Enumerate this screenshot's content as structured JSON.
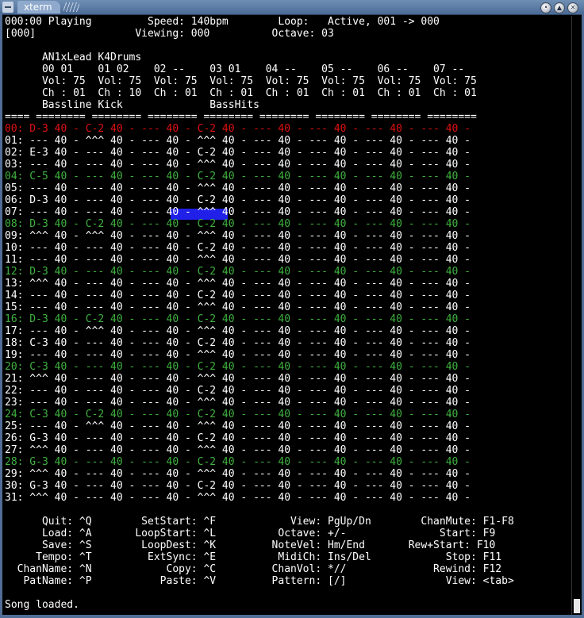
{
  "window": {
    "title": "xterm",
    "buttons": {
      "minimize": "•",
      "maximize": "▲",
      "close": "✕"
    }
  },
  "colors": {
    "accent_green": "#3fb13f",
    "current_row": "#e01010",
    "cursor": "#2020e8"
  },
  "status": {
    "line1": "000:00 Playing         Speed: 140bpm        Loop:   Active, 001 -> 000",
    "line2": "[000]                Viewing: 000          Octave: 03"
  },
  "channels": {
    "line1": "      AN1xLead K4Drums",
    "line2": "      00 01    01 02    02 --    03 01    04 --    05 --    06 --    07 --",
    "line3": "      Vol: 75  Vol: 75  Vol: 75  Vol: 75  Vol: 75  Vol: 75  Vol: 75  Vol: 75",
    "line4": "      Ch : 01  Ch : 10  Ch : 01  Ch : 01  Ch : 01  Ch : 01  Ch : 01  Ch : 01",
    "line5": "      Bassline Kick              BassHits",
    "separator": "==== ======== ======== ======== ======== ======== ======== ======== ========"
  },
  "pattern_rows": [
    "00: D-3 40 - C-2 40 - --- 40 - C-2 40 - --- 40 - --- 40 - --- 40 - --- 40 -",
    "01: --- 40 - ^^^ 40 - --- 40 - ^^^ 40 - --- 40 - --- 40 - --- 40 - --- 40 -",
    "02: E-3 40 - --- 40 - --- 40 - C-2 40 - --- 40 - --- 40 - --- 40 - --- 40 -",
    "03: --- 40 - --- 40 - --- 40 - ^^^ 40 - --- 40 - --- 40 - --- 40 - --- 40 -",
    "04: C-5 40 - --- 40 - --- 40 - C-2 40 - --- 40 - --- 40 - --- 40 - --- 40 -",
    "05: --- 40 - --- 40 - --- 40 - ^^^ 40 - --- 40 - --- 40 - --- 40 - --- 40 -",
    "06: D-3 40 - --- 40 - --- 40 - C-2 40 - --- 40 - --- 40 - --- 40 - --- 40 -",
    "07: --- 40 - --- 40 - --- 40 - ^^^ 40 - --- 40 - --- 40 - --- 40 - --- 40 -",
    "08: D-3 40 - C-2 40 - --- 40 - C-2 40 - --- 40 - --- 40 - --- 40 - --- 40 -",
    "09: ^^^ 40 - ^^^ 40 - --- 40 - ^^^ 40 - --- 40 - --- 40 - --- 40 - --- 40 -",
    "10: --- 40 - --- 40 - --- 40 - C-2 40 - --- 40 - --- 40 - --- 40 - --- 40 -",
    "11: --- 40 - --- 40 - --- 40 - ^^^ 40 - --- 40 - --- 40 - --- 40 - --- 40 -",
    "12: D-3 40 - --- 40 - --- 40 - C-2 40 - --- 40 - --- 40 - --- 40 - --- 40 -",
    "13: ^^^ 40 - --- 40 - --- 40 - ^^^ 40 - --- 40 - --- 40 - --- 40 - --- 40 -",
    "14: --- 40 - --- 40 - --- 40 - C-2 40 - --- 40 - --- 40 - --- 40 - --- 40 -",
    "15: --- 40 - --- 40 - --- 40 - ^^^ 40 - --- 40 - --- 40 - --- 40 - --- 40 -",
    "16: D-3 40 - C-2 40 - --- 40 - C-2 40 - --- 40 - --- 40 - --- 40 - --- 40 -",
    "17: --- 40 - ^^^ 40 - --- 40 - ^^^ 40 - --- 40 - --- 40 - --- 40 - --- 40 -",
    "18: C-3 40 - --- 40 - --- 40 - C-2 40 - --- 40 - --- 40 - --- 40 - --- 40 -",
    "19: --- 40 - --- 40 - --- 40 - ^^^ 40 - --- 40 - --- 40 - --- 40 - --- 40 -",
    "20: C-3 40 - --- 40 - --- 40 - C-2 40 - --- 40 - --- 40 - --- 40 - --- 40 -",
    "21: ^^^ 40 - --- 40 - --- 40 - ^^^ 40 - --- 40 - --- 40 - --- 40 - --- 40 -",
    "22: --- 40 - --- 40 - --- 40 - C-2 40 - --- 40 - --- 40 - --- 40 - --- 40 -",
    "23: --- 40 - --- 40 - --- 40 - ^^^ 40 - --- 40 - --- 40 - --- 40 - --- 40 -",
    "24: C-3 40 - C-2 40 - --- 40 - C-2 40 - --- 40 - --- 40 - --- 40 - --- 40 -",
    "25: --- 40 - ^^^ 40 - --- 40 - ^^^ 40 - --- 40 - --- 40 - --- 40 - --- 40 -",
    "26: G-3 40 - --- 40 - --- 40 - C-2 40 - --- 40 - --- 40 - --- 40 - --- 40 -",
    "27: ^^^ 40 - --- 40 - --- 40 - ^^^ 40 - --- 40 - --- 40 - --- 40 - --- 40 -",
    "28: G-3 40 - --- 40 - --- 40 - C-2 40 - --- 40 - --- 40 - --- 40 - --- 40 -",
    "29: ^^^ 40 - --- 40 - --- 40 - ^^^ 40 - --- 40 - --- 40 - --- 40 - --- 40 -",
    "30: G-3 40 - --- 40 - --- 40 - C-2 40 - --- 40 - --- 40 - --- 40 - --- 40 -",
    "31: ^^^ 40 - --- 40 - --- 40 - ^^^ 40 - --- 40 - --- 40 - --- 40 - --- 40 -"
  ],
  "help": [
    "      Quit: ^Q        SetStart: ^F            View: PgUp/Dn        ChanMute: F1-F8",
    "      Load: ^A       LoopStart: ^L          Octave: +/-               Start: F9",
    "      Save: ^S        LoopDest: ^K         NoteVel: Hm/End       Rew+Start: F10",
    "     Tempo: ^T         ExtSync: ^E          MidiCh: Ins/Del            Stop: F11",
    "  ChanName: ^N            Copy: ^C         ChanVol: *//              Rewind: F12",
    "   PatName: ^P           Paste: ^V         Pattern: [/]                View: <tab>"
  ],
  "message": "Song loaded."
}
